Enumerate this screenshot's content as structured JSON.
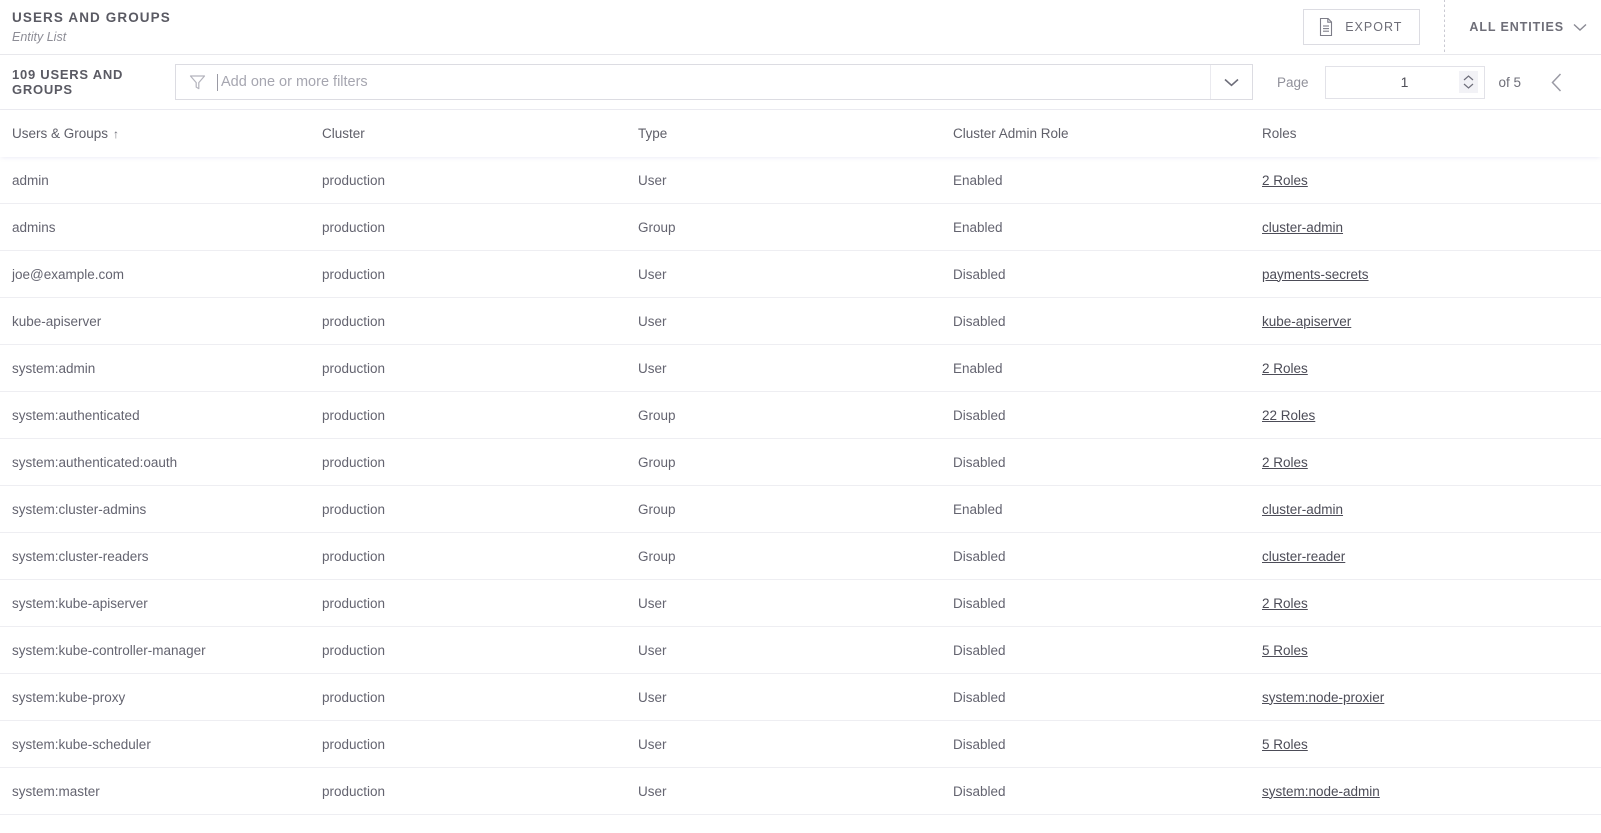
{
  "header": {
    "title": "USERS AND GROUPS",
    "subtitle": "Entity List",
    "export_label": "EXPORT",
    "entities_label": "ALL ENTITIES"
  },
  "toolbar": {
    "count_label": "109 USERS AND GROUPS",
    "filter_placeholder": "Add one or more filters",
    "filter_value": "",
    "page_label": "Page",
    "page_value": "1",
    "page_total": "of 5"
  },
  "table": {
    "columns": [
      {
        "label": "Users & Groups",
        "sort": "↑"
      },
      {
        "label": "Cluster",
        "sort": ""
      },
      {
        "label": "Type",
        "sort": ""
      },
      {
        "label": "Cluster Admin Role",
        "sort": ""
      },
      {
        "label": "Roles",
        "sort": ""
      }
    ],
    "rows": [
      {
        "name": "admin",
        "cluster": "production",
        "type": "User",
        "admin_role": "Enabled",
        "roles": "2 Roles"
      },
      {
        "name": "admins",
        "cluster": "production",
        "type": "Group",
        "admin_role": "Enabled",
        "roles": "cluster-admin"
      },
      {
        "name": "joe@example.com",
        "cluster": "production",
        "type": "User",
        "admin_role": "Disabled",
        "roles": "payments-secrets"
      },
      {
        "name": "kube-apiserver",
        "cluster": "production",
        "type": "User",
        "admin_role": "Disabled",
        "roles": "kube-apiserver"
      },
      {
        "name": "system:admin",
        "cluster": "production",
        "type": "User",
        "admin_role": "Enabled",
        "roles": "2 Roles"
      },
      {
        "name": "system:authenticated",
        "cluster": "production",
        "type": "Group",
        "admin_role": "Disabled",
        "roles": "22 Roles"
      },
      {
        "name": "system:authenticated:oauth",
        "cluster": "production",
        "type": "Group",
        "admin_role": "Disabled",
        "roles": "2 Roles"
      },
      {
        "name": "system:cluster-admins",
        "cluster": "production",
        "type": "Group",
        "admin_role": "Enabled",
        "roles": "cluster-admin"
      },
      {
        "name": "system:cluster-readers",
        "cluster": "production",
        "type": "Group",
        "admin_role": "Disabled",
        "roles": "cluster-reader"
      },
      {
        "name": "system:kube-apiserver",
        "cluster": "production",
        "type": "User",
        "admin_role": "Disabled",
        "roles": "2 Roles"
      },
      {
        "name": "system:kube-controller-manager",
        "cluster": "production",
        "type": "User",
        "admin_role": "Disabled",
        "roles": "5 Roles"
      },
      {
        "name": "system:kube-proxy",
        "cluster": "production",
        "type": "User",
        "admin_role": "Disabled",
        "roles": "system:node-proxier"
      },
      {
        "name": "system:kube-scheduler",
        "cluster": "production",
        "type": "User",
        "admin_role": "Disabled",
        "roles": "5 Roles"
      },
      {
        "name": "system:master",
        "cluster": "production",
        "type": "User",
        "admin_role": "Disabled",
        "roles": "system:node-admin"
      }
    ]
  },
  "icons": {
    "export": "document-icon",
    "entities_chevron": "chevron-down-icon",
    "filter": "funnel-icon",
    "filter_chevron": "chevron-down-icon",
    "page_stepper": "spinner-updown-icon",
    "prev_page": "chevron-left-icon"
  },
  "colors": {
    "text_primary": "#5a5a63",
    "text_secondary": "#8d8d96",
    "border": "#dcdce2",
    "row_border": "#eeeef2",
    "header_shadow": "#7878be"
  }
}
